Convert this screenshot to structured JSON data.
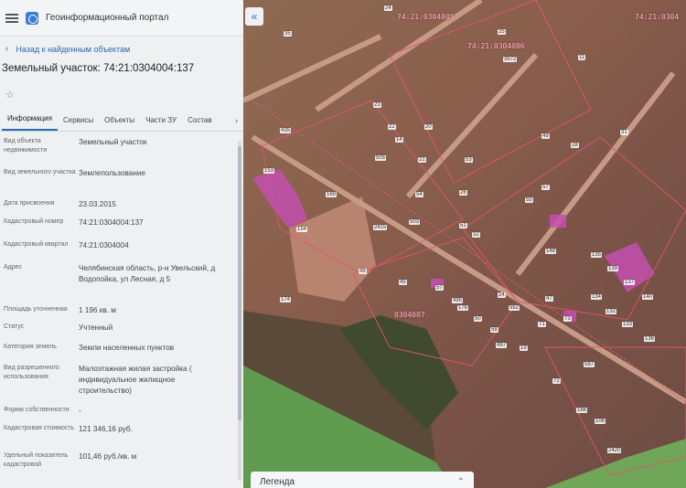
{
  "header": {
    "title": "Геоинформационный портал"
  },
  "nav": {
    "back_label": "Назад к найденным объектам"
  },
  "object": {
    "title": "Земельный участок: 74:21:0304004:137"
  },
  "tabs": [
    "Информация",
    "Сервисы",
    "Объекты",
    "Части ЗУ",
    "Состав"
  ],
  "details": [
    {
      "key": "Вид объекта недвижимости",
      "value": "Земельный участок"
    },
    {
      "key": "Вид земельного участка",
      "value": "Землепользование"
    },
    {
      "key": "Дата присвоения",
      "value": "23.03.2015"
    },
    {
      "key": "Кадастровый номер",
      "value": "74:21:0304004:137"
    },
    {
      "key": "Кадастровый квартал",
      "value": "74:21:0304004"
    },
    {
      "key": "Адрес",
      "value": "Челябинская область, р-н Увельский, д Водопойка, ул Лесная, д 5"
    },
    {
      "key": "Площадь уточненная",
      "value": "1 196 кв. м"
    },
    {
      "key": "Статус",
      "value": "Учтенный"
    },
    {
      "key": "Категория земель",
      "value": "Земли населенных пунктов"
    },
    {
      "key": "Вид разрешенного использования",
      "value": "Малоэтажная жилая застройка ( индивидуальное жилищное строительство)"
    },
    {
      "key": "Форма собственности",
      "value": "-"
    },
    {
      "key": "Кадастровая стоимость",
      "value": "121 346,16 руб."
    },
    {
      "key": "Удельный показатель кадастровой",
      "value": "101,46 руб./кв. м"
    }
  ],
  "map": {
    "legend_label": "Легенда",
    "labels": [
      "74:21:0304005",
      "74:21:0304006",
      "74:21:0304",
      "0304007"
    ],
    "parcels": [
      "153",
      "169",
      "154",
      "2415",
      "174",
      "505",
      "503",
      "46",
      "45",
      "57",
      "176",
      "495",
      "50",
      "58",
      "497",
      "19",
      "73",
      "71",
      "562",
      "24",
      "47",
      "148",
      "135",
      "139",
      "137",
      "134",
      "140",
      "132",
      "133",
      "136",
      "587",
      "72",
      "166",
      "106",
      "2420",
      "54",
      "26",
      "32",
      "51",
      "55",
      "57",
      "49",
      "28",
      "11",
      "31",
      "23",
      "22",
      "24",
      "14",
      "435",
      "21",
      "20",
      "53",
      "25",
      "3972",
      "35"
    ]
  },
  "icons": {
    "menu": "hamburger-icon",
    "logo": "portal-logo-icon",
    "back": "chevron-left-icon",
    "favorite": "star-icon",
    "collapse": "double-chevron-left-icon",
    "legend_toggle": "chevron-up-icon"
  },
  "colors": {
    "accent": "#2b6cb0",
    "parcel_highlight": "#c64fb0",
    "boundary": "#e25670"
  }
}
